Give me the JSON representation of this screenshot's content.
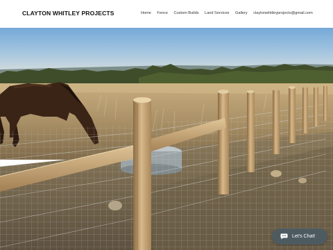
{
  "header": {
    "brand": "CLAYTON WHITLEY PROJECTS",
    "nav": [
      {
        "label": "Home"
      },
      {
        "label": "Fence"
      },
      {
        "label": "Custom Builds"
      },
      {
        "label": "Land Services"
      },
      {
        "label": "Gallery"
      }
    ],
    "email": "claytonwhitleyprojects@gmail.com"
  },
  "hero": {
    "scene": "horse grazing behind a wooden post and wire fence in a field at sunset"
  },
  "chat": {
    "label": "Let's Chat!",
    "icon": "chat-bubble-icon"
  },
  "colors": {
    "header_bg": "#ffffff",
    "brand_text": "#111111",
    "chat_bg": "#4d5b61"
  }
}
